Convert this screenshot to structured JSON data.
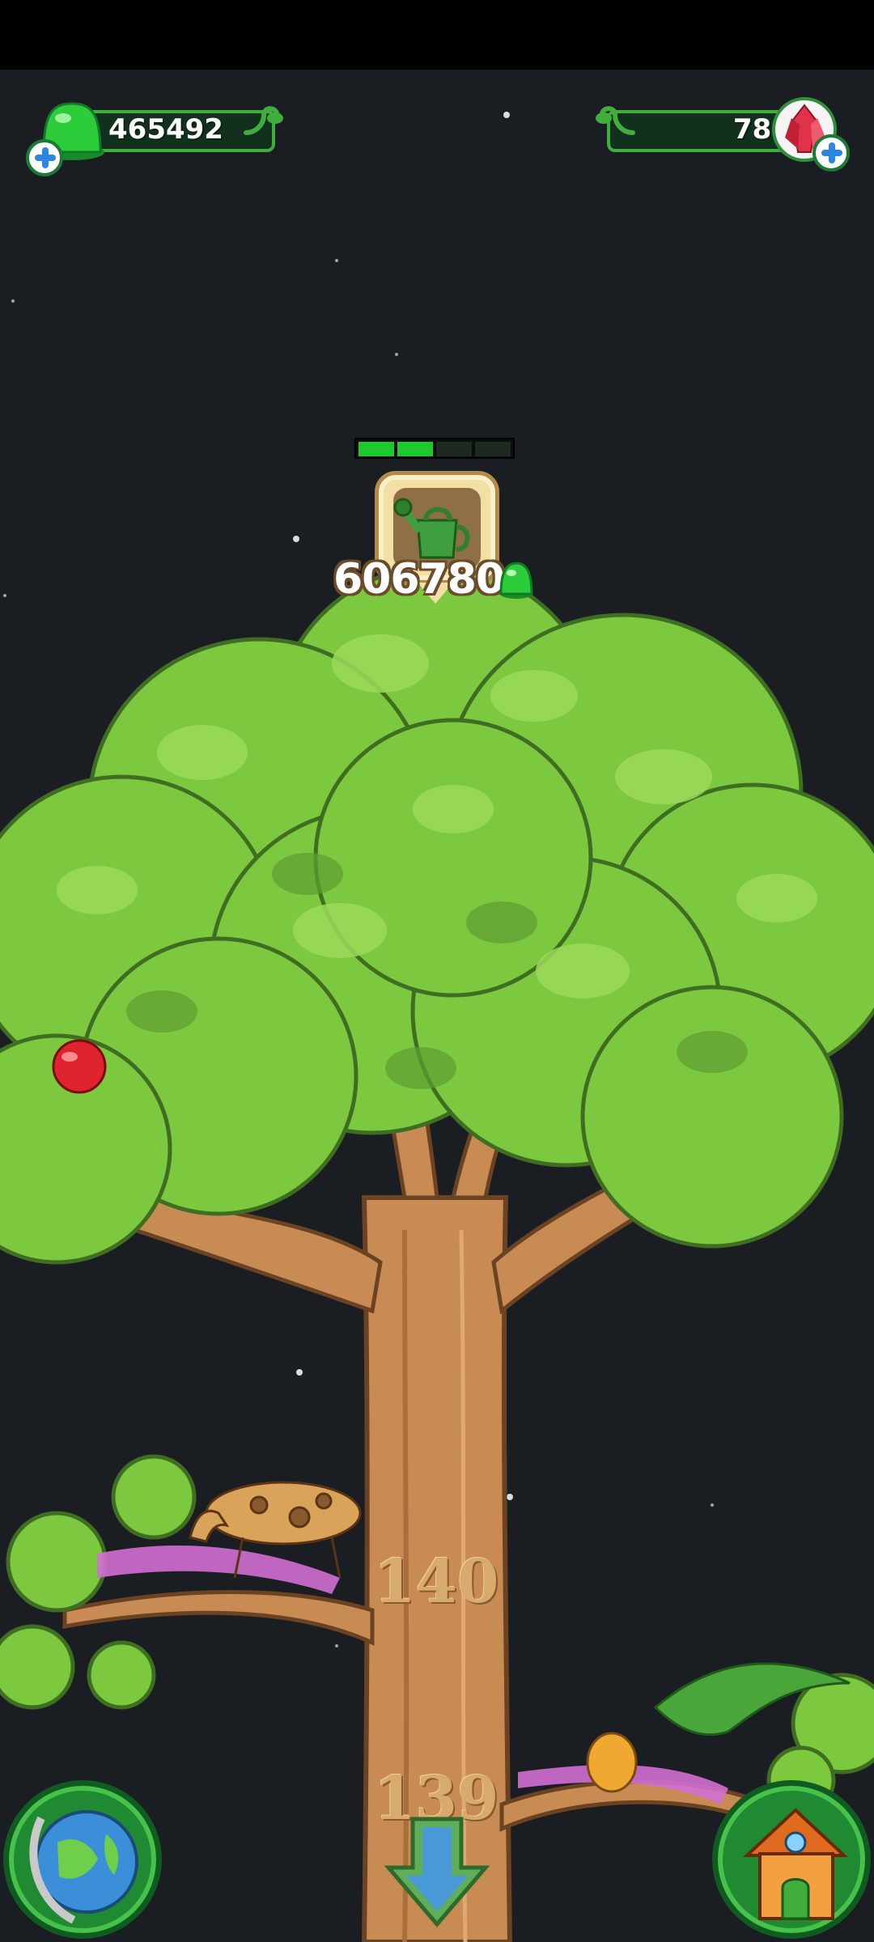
{
  "hud": {
    "jelly_count": "465492",
    "crystal_count": "78"
  },
  "growth": {
    "progress_segments_total": 4,
    "progress_segments_filled": 2,
    "cost": "606780"
  },
  "branches": {
    "upper_level": "140",
    "lower_level": "139"
  },
  "colors": {
    "leaf": "#7cc93f",
    "leaf_dark": "#4e8f2c",
    "trunk": "#c88b54",
    "trunk_dark": "#8a5a2e",
    "hud_green": "#3fae3d",
    "jelly": "#2ccc3a",
    "crystal": "#e0324a",
    "progress_fill": "#1ec82e",
    "sky": "#1a1d21"
  },
  "icons": {
    "jelly": "green-jelly-icon",
    "crystal": "red-crystal-icon",
    "watering_can": "watering-can-icon",
    "globe": "globe-icon",
    "home": "home-icon",
    "down": "down-arrow-icon"
  }
}
